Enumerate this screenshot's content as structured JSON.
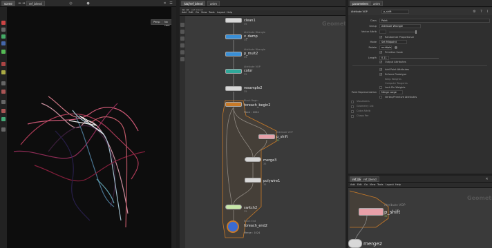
{
  "viewport": {
    "tabs": [
      "scene",
      "ref_blend"
    ],
    "path": "/obj"
  },
  "network": {
    "tabs": [
      "/obj/ref_blend",
      "anim"
    ],
    "menu": [
      "Add",
      "Edit",
      "Go",
      "View",
      "Tools",
      "Layout",
      "Help"
    ],
    "path": "ref_blend",
    "context_title": "Geometry",
    "nodes": [
      {
        "label": "clean1",
        "sub": "",
        "info": "35"
      },
      {
        "label": "v_damp",
        "sub": "Attribute Wrangle",
        "info": "35"
      },
      {
        "label": "p_mult2",
        "sub": "Attribute Wrangle",
        "info": "35"
      },
      {
        "label": "color",
        "sub": "Attribute VOP",
        "info": "35"
      },
      {
        "label": "resample2",
        "sub": "",
        "info": "35"
      },
      {
        "label": "foreach_begin2",
        "sub": "Block Begin",
        "info": "Piece : 1024"
      },
      {
        "label": "p_shift",
        "sub": "Attribute VOP",
        "info": "35"
      },
      {
        "label": "merge3",
        "sub": "",
        "info": "35"
      },
      {
        "label": "polywire1",
        "sub": "",
        "info": "35"
      },
      {
        "label": "switch2",
        "sub": "",
        "info": "35"
      },
      {
        "label": "foreach_end2",
        "sub": "Block End",
        "info": "Merge : 1024"
      }
    ]
  },
  "params": {
    "tabs": [
      "parameters",
      "anim"
    ],
    "node_type": "Attribute VOP",
    "node_name": "p_shift",
    "rows": [
      {
        "label": "Class",
        "value": "Point"
      },
      {
        "label": "Group",
        "value": "Attribute Wrangle"
      },
      {
        "label": "Vector Attrib",
        "value": ""
      },
      {
        "label": "Mode",
        "value": "Set Midpoint"
      },
      {
        "label": "Rotate",
        "value": "multiple"
      },
      {
        "label": "Scale",
        "value": "Primitive Scale"
      },
      {
        "label": "Length",
        "value": "0.11"
      }
    ],
    "checks": [
      {
        "label": "Output Attributes",
        "on": true
      },
      {
        "label": "Add Point Attributes",
        "on": true
      },
      {
        "label": "Enforce Prototype",
        "on": true
      },
      {
        "label": "Keep Weights",
        "on": false
      },
      {
        "label": "Compute Tangents",
        "on": false
      },
      {
        "label": "Lock Pin Weights",
        "on": false
      }
    ],
    "extra": [
      {
        "label": "Point Representation",
        "value": "Merge Large"
      },
      {
        "label": "Vertex/Primitive Attributes",
        "value": ""
      }
    ],
    "side_list": [
      "Visualizers",
      "Geometry List",
      "Color Attrib",
      "Chaos Per"
    ]
  },
  "lower": {
    "tabs": [
      "ref_blend",
      "ref_blend"
    ],
    "menu": [
      "Add",
      "Edit",
      "Go",
      "View",
      "Tools",
      "Layout",
      "Help"
    ],
    "context_title": "Geometry",
    "nodes": [
      {
        "label": "p_shift",
        "sub": "Attribute VOP",
        "info": "35"
      },
      {
        "label": "merge2",
        "sub": "",
        "info": ""
      }
    ]
  },
  "colors": {
    "wrangle": "#3a8fd6",
    "vop": "#e8a0a8",
    "color_node": "#2fa89a",
    "block": "#c87a28",
    "switch": "#c8e8a8",
    "end": "#3a6ad0"
  }
}
